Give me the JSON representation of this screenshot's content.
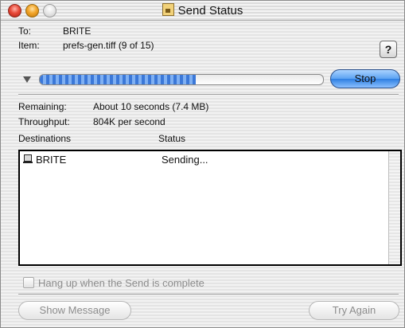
{
  "window": {
    "title": "Send Status"
  },
  "info": {
    "to_label": "To:",
    "to_value": "BRITE",
    "item_label": "Item:",
    "item_value": "prefs-gen.tiff  (9 of 15)"
  },
  "help": {
    "label": "?"
  },
  "progress": {
    "fraction": 0.55,
    "stop_label": "Stop"
  },
  "stats": {
    "remaining_label": "Remaining:",
    "remaining_value": "About 10 seconds  (7.4 MB)",
    "throughput_label": "Throughput:",
    "throughput_value": "804K per second"
  },
  "destinations": {
    "col_destinations": "Destinations",
    "col_status": "Status",
    "rows": [
      {
        "name": "BRITE",
        "status": "Sending..."
      }
    ]
  },
  "options": {
    "hangup_label": "Hang up when the Send is complete",
    "hangup_checked": false
  },
  "buttons": {
    "show_message": "Show Message",
    "try_again": "Try Again"
  }
}
